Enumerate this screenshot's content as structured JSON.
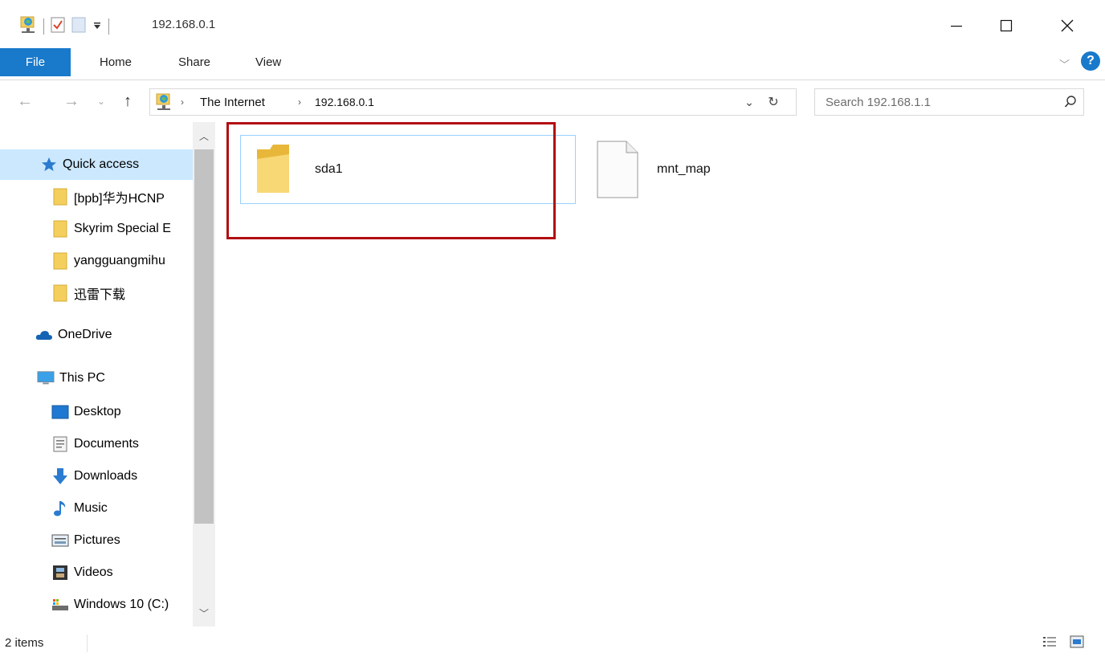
{
  "window": {
    "title": "192.168.0.1",
    "minimize_label": "—",
    "maximize_label": "☐",
    "close_label": "✕"
  },
  "ribbon": {
    "tabs": [
      "File",
      "Home",
      "Share",
      "View"
    ],
    "help_label": "?"
  },
  "address_bar": {
    "crumbs": [
      "The Internet",
      "192.168.0.1"
    ]
  },
  "search": {
    "placeholder": "Search 192.168.1.1"
  },
  "sidebar": {
    "quick_access": "Quick access",
    "pinned": [
      "[bpb]华为HCNP",
      "Skyrim Special E",
      "yangguangmihu",
      "迅雷下载"
    ],
    "onedrive": "OneDrive",
    "this_pc": "This PC",
    "pc_items": [
      "Desktop",
      "Documents",
      "Downloads",
      "Music",
      "Pictures",
      "Videos",
      "Windows 10 (C:)"
    ]
  },
  "files": [
    {
      "name": "sda1",
      "type": "folder"
    },
    {
      "name": "mnt_map",
      "type": "file"
    }
  ],
  "status": {
    "items_text": "2 items"
  },
  "colors": {
    "accent": "#1979ca",
    "selection": "#cce8ff",
    "highlight_box": "#b20e12",
    "folder": "#f4cf5e"
  }
}
